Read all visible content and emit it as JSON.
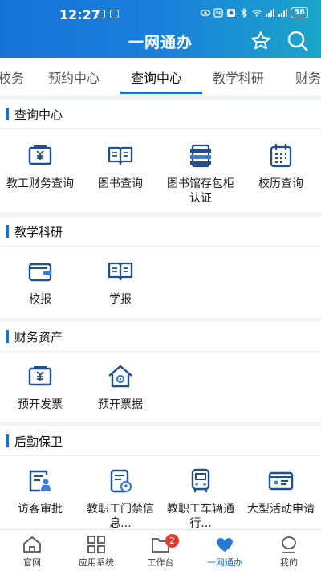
{
  "status_bar": {
    "time": "12:27",
    "battery": "58"
  },
  "header": {
    "title": "一网通办"
  },
  "tabs": [
    {
      "label": "校务"
    },
    {
      "label": "预约中心"
    },
    {
      "label": "查询中心"
    },
    {
      "label": "教学科研"
    },
    {
      "label": "财务"
    }
  ],
  "sections": [
    {
      "title": "查询中心",
      "items": [
        {
          "label": "教工财务查询",
          "icon": "finance-check-icon"
        },
        {
          "label": "图书查询",
          "icon": "book-icon"
        },
        {
          "label": "图书馆存包柜认证",
          "icon": "locker-icon"
        },
        {
          "label": "校历查询",
          "icon": "calendar-icon"
        }
      ]
    },
    {
      "title": "教学科研",
      "items": [
        {
          "label": "校报",
          "icon": "wallet-icon"
        },
        {
          "label": "学报",
          "icon": "book-icon"
        }
      ]
    },
    {
      "title": "财务资产",
      "items": [
        {
          "label": "预开发票",
          "icon": "invoice-icon"
        },
        {
          "label": "预开票据",
          "icon": "house-gear-icon"
        }
      ]
    },
    {
      "title": "后勤保卫",
      "items": [
        {
          "label": "访客审批",
          "icon": "visitor-approval-icon"
        },
        {
          "label": "教职工门禁信息...",
          "icon": "access-card-icon"
        },
        {
          "label": "教职工车辆通行...",
          "icon": "bus-icon"
        },
        {
          "label": "大型活动申请",
          "icon": "id-card-icon"
        }
      ]
    }
  ],
  "bottom_nav": [
    {
      "label": "官网",
      "icon": "home-icon"
    },
    {
      "label": "应用系统",
      "icon": "grid-icon"
    },
    {
      "label": "工作台",
      "icon": "folder-icon",
      "badge": "2"
    },
    {
      "label": "一网通办",
      "icon": "heart-icon",
      "active": true
    },
    {
      "label": "我的",
      "icon": "profile-icon"
    }
  ],
  "colors": {
    "primary": "#1a6fd0",
    "badge": "#e23a2e",
    "icon_blue": "#1f4f8f"
  }
}
